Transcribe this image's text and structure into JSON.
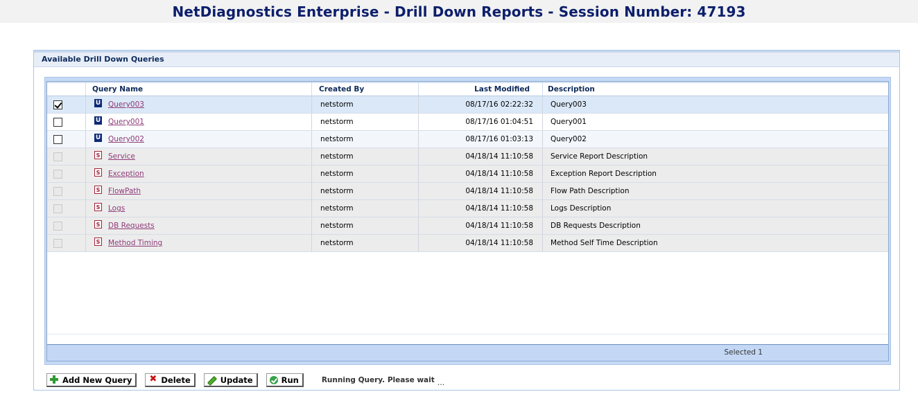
{
  "header": {
    "title": "NetDiagnostics Enterprise - Drill Down Reports - Session Number: 47193"
  },
  "panel": {
    "title": "Available Drill Down Queries"
  },
  "table": {
    "columns": {
      "name": "Query  Name",
      "created_by": "Created By",
      "last_modified": "Last Modified",
      "description": "Description"
    },
    "rows": [
      {
        "checked": true,
        "type": "U",
        "name": "Query003",
        "created_by": "netstorm",
        "last_modified": "08/17/16 02:22:32",
        "description": "Query003"
      },
      {
        "checked": false,
        "type": "U",
        "name": "Query001",
        "created_by": "netstorm",
        "last_modified": "08/17/16 01:04:51",
        "description": "Query001"
      },
      {
        "checked": false,
        "type": "U",
        "name": "Query002",
        "created_by": "netstorm",
        "last_modified": "08/17/16 01:03:13",
        "description": "Query002"
      },
      {
        "checked": false,
        "type": "S",
        "name": "Service",
        "created_by": "netstorm",
        "last_modified": "04/18/14 11:10:58",
        "description": "Service Report Description"
      },
      {
        "checked": false,
        "type": "S",
        "name": "Exception",
        "created_by": "netstorm",
        "last_modified": "04/18/14 11:10:58",
        "description": "Exception Report Description"
      },
      {
        "checked": false,
        "type": "S",
        "name": "FlowPath",
        "created_by": "netstorm",
        "last_modified": "04/18/14 11:10:58",
        "description": "Flow Path Description"
      },
      {
        "checked": false,
        "type": "S",
        "name": "Logs",
        "created_by": "netstorm",
        "last_modified": "04/18/14 11:10:58",
        "description": "Logs Description"
      },
      {
        "checked": false,
        "type": "S",
        "name": "DB Requests",
        "created_by": "netstorm",
        "last_modified": "04/18/14 11:10:58",
        "description": "DB Requests Description"
      },
      {
        "checked": false,
        "type": "S",
        "name": "Method Timing",
        "created_by": "netstorm",
        "last_modified": "04/18/14 11:10:58",
        "description": "Method Self Time Description"
      }
    ],
    "footer": "Selected 1"
  },
  "toolbar": {
    "add_label": "Add New Query",
    "delete_label": "Delete",
    "update_label": "Update",
    "run_label": "Run",
    "status": "Running Query. Please wait",
    "status_dots": "..."
  },
  "icons": {
    "user_query": "user-query-icon",
    "system_query": "system-query-icon",
    "add": "plus-icon",
    "delete": "x-icon",
    "update": "pencil-icon",
    "run": "check-circle-icon"
  },
  "colors": {
    "title": "#0d1f6b",
    "link": "#8e3a78",
    "selected_row": "#dbe8f7",
    "system_row": "#ececec",
    "grid_footer": "#c4d8f5"
  }
}
